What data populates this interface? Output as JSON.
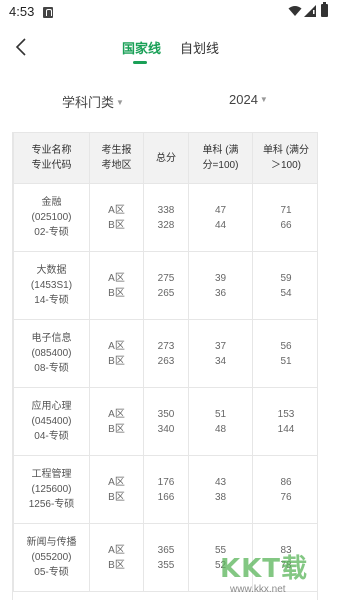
{
  "status_bar": {
    "time": "4:53"
  },
  "tabs": [
    {
      "label": "国家线",
      "active": true
    },
    {
      "label": "自划线",
      "active": false
    }
  ],
  "filters": {
    "subject": "学科门类",
    "year": "2024"
  },
  "table": {
    "headers": [
      "专业名称\n专业代码",
      "考生报\n考地区",
      "总分",
      "单科 (满\n分=100)",
      "单科 (满分\n＞100)"
    ],
    "rows": [
      {
        "name": "金融",
        "code": "(025100)",
        "type": "02-专硕",
        "regions": [
          "A区",
          "B区"
        ],
        "total": [
          "338",
          "328"
        ],
        "single100": [
          "47",
          "44"
        ],
        "singleOver": [
          "71",
          "66"
        ]
      },
      {
        "name": "大数据",
        "code": "(1453S1)",
        "type": "14-专硕",
        "regions": [
          "A区",
          "B区"
        ],
        "total": [
          "275",
          "265"
        ],
        "single100": [
          "39",
          "36"
        ],
        "singleOver": [
          "59",
          "54"
        ]
      },
      {
        "name": "电子信息",
        "code": "(085400)",
        "type": "08-专硕",
        "regions": [
          "A区",
          "B区"
        ],
        "total": [
          "273",
          "263"
        ],
        "single100": [
          "37",
          "34"
        ],
        "singleOver": [
          "56",
          "51"
        ]
      },
      {
        "name": "应用心理",
        "code": "(045400)",
        "type": "04-专硕",
        "regions": [
          "A区",
          "B区"
        ],
        "total": [
          "350",
          "340"
        ],
        "single100": [
          "51",
          "48"
        ],
        "singleOver": [
          "153",
          "144"
        ]
      },
      {
        "name": "工程管理",
        "code": "(125600)",
        "type": "1256-专硕",
        "regions": [
          "A区",
          "B区"
        ],
        "total": [
          "176",
          "166"
        ],
        "single100": [
          "43",
          "38"
        ],
        "singleOver": [
          "86",
          "76"
        ]
      },
      {
        "name": "新闻与传播",
        "code": "(055200)",
        "type": "05-专硕",
        "regions": [
          "A区",
          "B区"
        ],
        "total": [
          "365",
          "355"
        ],
        "single100": [
          "55",
          "52"
        ],
        "singleOver": [
          "83",
          "78"
        ]
      }
    ]
  },
  "watermark": {
    "logo": "KKT载",
    "url": "www.kkx.net"
  },
  "colors": {
    "accent": "#1aa057",
    "header_bg": "#f2f2f2",
    "border": "#e6e6e6"
  }
}
